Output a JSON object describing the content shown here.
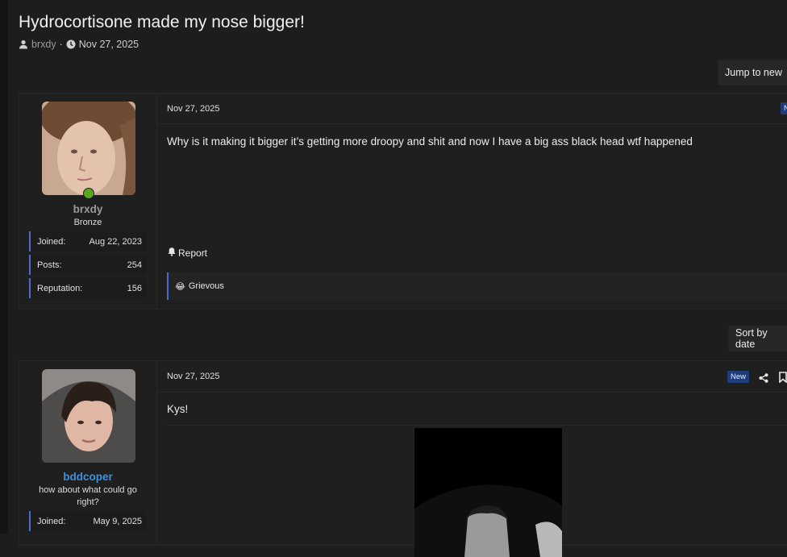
{
  "thread": {
    "title": "Hydrocortisone made my nose bigger!",
    "author": "brxdy",
    "separator": "·",
    "date": "Nov 27, 2025"
  },
  "controls": {
    "jump_label": "Jump to new",
    "sort_label": "Sort by date"
  },
  "posts": [
    {
      "username": "brxdy",
      "user_title": "Bronze",
      "online": true,
      "stats": [
        {
          "label": "Joined:",
          "value": "Aug 22, 2023"
        },
        {
          "label": "Posts:",
          "value": "254"
        },
        {
          "label": "Reputation:",
          "value": "156"
        }
      ],
      "date": "Nov 27, 2025",
      "badge": "N",
      "body": "Why is it making it bigger it’s getting more droopy and shit and now I have a big ass black head wtf happened",
      "report_label": "Report",
      "reaction": {
        "emoji": "😂",
        "label": "Grievous"
      }
    },
    {
      "username": "bddcoper",
      "user_title": "how about what could go right?",
      "stats": [
        {
          "label": "Joined:",
          "value": "May 9, 2025"
        }
      ],
      "date": "Nov 27, 2025",
      "badge": "New",
      "body": "Kys!"
    }
  ],
  "colors": {
    "background": "#1d1d1d",
    "accent_border": "#4a6bd1",
    "username_blue": "#3a92e0",
    "online_green": "#5aa61c",
    "badge_bg": "#1f3d7a"
  },
  "icons": {
    "author": "user-icon",
    "date": "clock-icon",
    "report": "bell-icon",
    "share": "share-icon",
    "bookmark": "bookmark-icon"
  }
}
